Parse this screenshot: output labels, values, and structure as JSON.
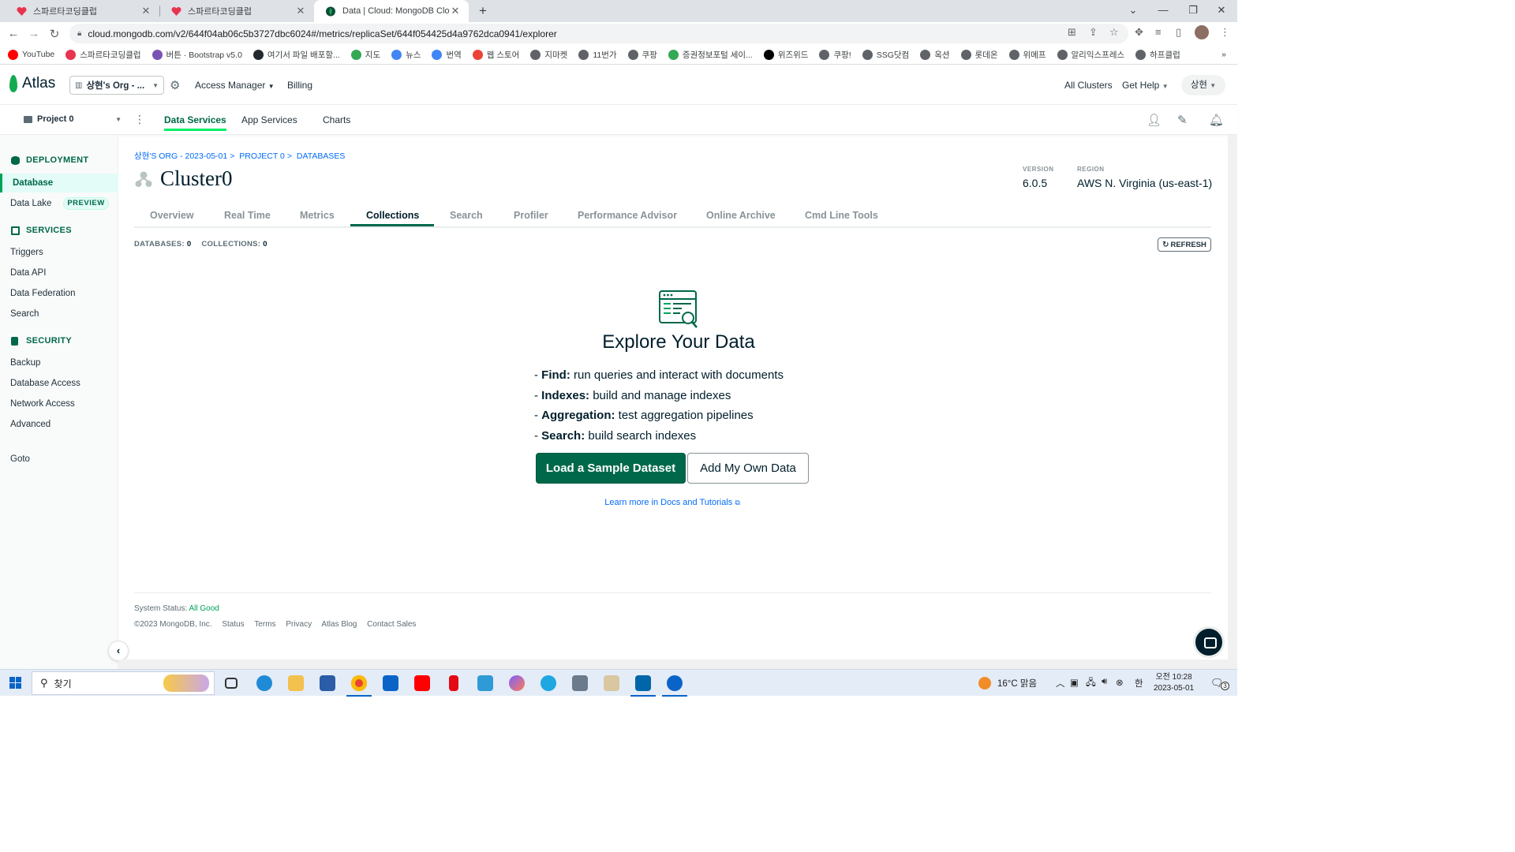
{
  "browser": {
    "tabs": [
      {
        "title": "스파르타코딩클럽"
      },
      {
        "title": "스파르타코딩클럽"
      },
      {
        "title": "Data | Cloud: MongoDB Cloud"
      }
    ],
    "url": "cloud.mongodb.com/v2/644f04ab06c5b3727dbc6024#/metrics/replicaSet/644f054425d4a9762dca0941/explorer",
    "bookmarks": [
      {
        "label": "YouTube",
        "color": "#ff0000"
      },
      {
        "label": "스파르타코딩클럽",
        "color": "#e8344e"
      },
      {
        "label": "버튼 · Bootstrap v5.0",
        "color": "#7952b3"
      },
      {
        "label": "여기서 파일 배포할...",
        "color": "#24292f"
      },
      {
        "label": "지도",
        "color": "#34a853"
      },
      {
        "label": "뉴스",
        "color": "#4285f4"
      },
      {
        "label": "번역",
        "color": "#4285f4"
      },
      {
        "label": "웹 스토어",
        "color": "#ea4335"
      },
      {
        "label": "지마켓",
        "color": "#5f6368"
      },
      {
        "label": "11번가",
        "color": "#5f6368"
      },
      {
        "label": "쿠팡",
        "color": "#5f6368"
      },
      {
        "label": "증권정보포털 세이...",
        "color": "#34a853"
      },
      {
        "label": "위즈위드",
        "color": "#000000"
      },
      {
        "label": "쿠팡!",
        "color": "#5f6368"
      },
      {
        "label": "SSG닷컴",
        "color": "#5f6368"
      },
      {
        "label": "옥션",
        "color": "#5f6368"
      },
      {
        "label": "롯데온",
        "color": "#5f6368"
      },
      {
        "label": "위메프",
        "color": "#5f6368"
      },
      {
        "label": "알리익스프레스",
        "color": "#5f6368"
      },
      {
        "label": "하프클럽",
        "color": "#5f6368"
      }
    ],
    "bookmarks_overflow": "»"
  },
  "atlas": {
    "logo": "Atlas",
    "org": "상현's Org - ...",
    "nav": {
      "access_manager": "Access Manager",
      "billing": "Billing"
    },
    "right": {
      "all_clusters": "All Clusters",
      "get_help": "Get Help",
      "user": "상현"
    },
    "project": "Project 0",
    "project_tabs": [
      "Data Services",
      "App Services",
      "Charts"
    ]
  },
  "sidebar": {
    "deployment": "DEPLOYMENT",
    "database": "Database",
    "data_lake": "Data Lake",
    "preview": "PREVIEW",
    "services": "SERVICES",
    "services_items": [
      "Triggers",
      "Data API",
      "Data Federation",
      "Search"
    ],
    "security": "SECURITY",
    "security_items": [
      "Backup",
      "Database Access",
      "Network Access",
      "Advanced"
    ],
    "goto": "Goto"
  },
  "main": {
    "breadcrumb": [
      "상현'S ORG - 2023-05-01",
      "PROJECT 0",
      "DATABASES"
    ],
    "breadcrumb_sep": ">",
    "cluster_name": "Cluster0",
    "version_label": "VERSION",
    "version": "6.0.5",
    "region_label": "REGION",
    "region": "AWS N. Virginia (us-east-1)",
    "tabs": [
      "Overview",
      "Real Time",
      "Metrics",
      "Collections",
      "Search",
      "Profiler",
      "Performance Advisor",
      "Online Archive",
      "Cmd Line Tools"
    ],
    "active_tab": "Collections",
    "databases_label": "DATABASES:",
    "databases_count": "0",
    "collections_label": "COLLECTIONS:",
    "collections_count": "0",
    "refresh": "REFRESH",
    "explore": {
      "title": "Explore Your Data",
      "items": [
        {
          "key": "Find:",
          "text": "run queries and interact with documents"
        },
        {
          "key": "Indexes:",
          "text": "build and manage indexes"
        },
        {
          "key": "Aggregation:",
          "text": "test aggregation pipelines"
        },
        {
          "key": "Search:",
          "text": "build search indexes"
        }
      ],
      "primary_button": "Load a Sample Dataset",
      "secondary_button": "Add My Own Data",
      "learn_more": "Learn more in Docs and Tutorials"
    },
    "footer": {
      "status_label": "System Status:",
      "status_value": "All Good",
      "copyright": "©2023 MongoDB, Inc.",
      "links": [
        "Status",
        "Terms",
        "Privacy",
        "Atlas Blog",
        "Contact Sales"
      ]
    }
  },
  "taskbar": {
    "search_placeholder": "찾기",
    "weather": "16°C 맑음",
    "ime": "한",
    "time": "오전 10:28",
    "date": "2023-05-01",
    "notifications": "3"
  }
}
